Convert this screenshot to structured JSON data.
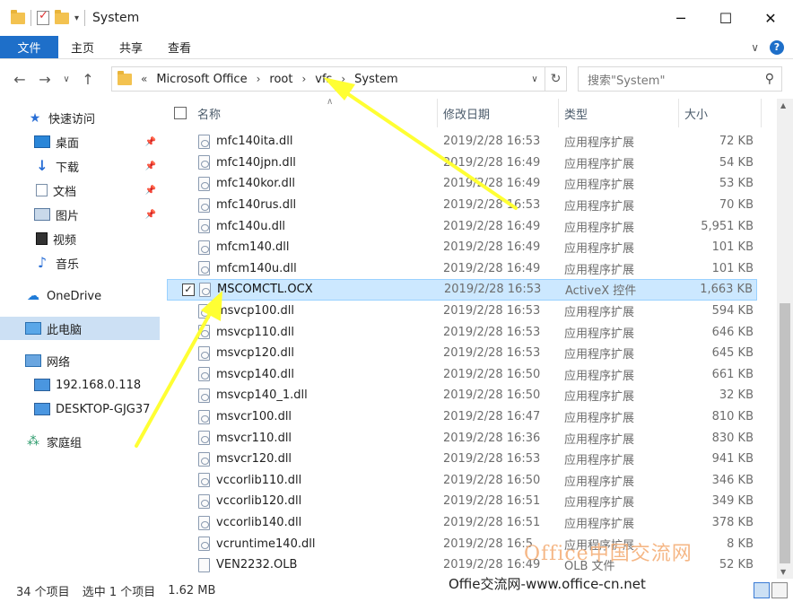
{
  "titlebar": {
    "title": "System",
    "quick_access_dropdown": "▾",
    "minimize": "─",
    "maximize": "☐",
    "close": "✕"
  },
  "ribbon": {
    "tabs": [
      "文件",
      "主页",
      "共享",
      "查看"
    ],
    "collapse": "∨",
    "help": "?"
  },
  "nav": {
    "back": "←",
    "forward": "→",
    "recent": "∨",
    "up": "↑",
    "path_prefix": "«",
    "breadcrumbs": [
      "Microsoft Office",
      "root",
      "vfs",
      "System"
    ],
    "refresh": "↻",
    "search_placeholder": "搜索\"System\""
  },
  "sidebar": {
    "items": [
      {
        "label": "快速访问",
        "icon": "star-icon"
      },
      {
        "label": "桌面",
        "icon": "desktop-icon",
        "pinned": true
      },
      {
        "label": "下载",
        "icon": "download-icon",
        "pinned": true
      },
      {
        "label": "文档",
        "icon": "document-icon",
        "pinned": true
      },
      {
        "label": "图片",
        "icon": "pictures-icon",
        "pinned": true
      },
      {
        "label": "视频",
        "icon": "video-icon"
      },
      {
        "label": "音乐",
        "icon": "music-icon"
      },
      {
        "label": "OneDrive",
        "icon": "onedrive-icon"
      },
      {
        "label": "此电脑",
        "icon": "this-pc-icon",
        "selected": true
      },
      {
        "label": "网络",
        "icon": "network-icon"
      },
      {
        "label": "192.168.0.118",
        "icon": "computer-icon"
      },
      {
        "label": "DESKTOP-GJG37",
        "icon": "computer-icon"
      },
      {
        "label": "家庭组",
        "icon": "homegroup-icon"
      }
    ]
  },
  "list": {
    "columns": [
      "名称",
      "修改日期",
      "类型",
      "大小"
    ],
    "rows": [
      {
        "name": "mfc140ita.dll",
        "date": "2019/2/28 16:53",
        "type": "应用程序扩展",
        "size": "72 KB"
      },
      {
        "name": "mfc140jpn.dll",
        "date": "2019/2/28 16:49",
        "type": "应用程序扩展",
        "size": "54 KB"
      },
      {
        "name": "mfc140kor.dll",
        "date": "2019/2/28 16:49",
        "type": "应用程序扩展",
        "size": "53 KB"
      },
      {
        "name": "mfc140rus.dll",
        "date": "2019/2/28 16:53",
        "type": "应用程序扩展",
        "size": "70 KB"
      },
      {
        "name": "mfc140u.dll",
        "date": "2019/2/28 16:49",
        "type": "应用程序扩展",
        "size": "5,951 KB"
      },
      {
        "name": "mfcm140.dll",
        "date": "2019/2/28 16:49",
        "type": "应用程序扩展",
        "size": "101 KB"
      },
      {
        "name": "mfcm140u.dll",
        "date": "2019/2/28 16:49",
        "type": "应用程序扩展",
        "size": "101 KB"
      },
      {
        "name": "MSCOMCTL.OCX",
        "date": "2019/2/28 16:53",
        "type": "ActiveX 控件",
        "size": "1,663 KB",
        "selected": true
      },
      {
        "name": "msvcp100.dll",
        "date": "2019/2/28 16:53",
        "type": "应用程序扩展",
        "size": "594 KB"
      },
      {
        "name": "msvcp110.dll",
        "date": "2019/2/28 16:53",
        "type": "应用程序扩展",
        "size": "646 KB"
      },
      {
        "name": "msvcp120.dll",
        "date": "2019/2/28 16:53",
        "type": "应用程序扩展",
        "size": "645 KB"
      },
      {
        "name": "msvcp140.dll",
        "date": "2019/2/28 16:50",
        "type": "应用程序扩展",
        "size": "661 KB"
      },
      {
        "name": "msvcp140_1.dll",
        "date": "2019/2/28 16:50",
        "type": "应用程序扩展",
        "size": "32 KB"
      },
      {
        "name": "msvcr100.dll",
        "date": "2019/2/28 16:47",
        "type": "应用程序扩展",
        "size": "810 KB"
      },
      {
        "name": "msvcr110.dll",
        "date": "2019/2/28 16:36",
        "type": "应用程序扩展",
        "size": "830 KB"
      },
      {
        "name": "msvcr120.dll",
        "date": "2019/2/28 16:53",
        "type": "应用程序扩展",
        "size": "941 KB"
      },
      {
        "name": "vccorlib110.dll",
        "date": "2019/2/28 16:50",
        "type": "应用程序扩展",
        "size": "346 KB"
      },
      {
        "name": "vccorlib120.dll",
        "date": "2019/2/28 16:51",
        "type": "应用程序扩展",
        "size": "349 KB"
      },
      {
        "name": "vccorlib140.dll",
        "date": "2019/2/28 16:51",
        "type": "应用程序扩展",
        "size": "378 KB"
      },
      {
        "name": "vcruntime140.dll",
        "date": "2019/2/28 16:5",
        "type": "应用程序扩展",
        "size": "8 KB"
      },
      {
        "name": "VEN2232.OLB",
        "date": "2019/2/28 16:49",
        "type": "OLB 文件",
        "size": "52 KB",
        "plain": true
      }
    ]
  },
  "status": {
    "count": "34 个项目",
    "selected": "选中 1 个项目",
    "size": "1.62 MB"
  },
  "watermark": {
    "text1": "Office中国交流网",
    "text2": "Offie交流网-www.office-cn.net"
  },
  "colors": {
    "accent": "#1e6fc9",
    "selection": "#cce8ff",
    "annotation_arrow": "#ffff33"
  }
}
